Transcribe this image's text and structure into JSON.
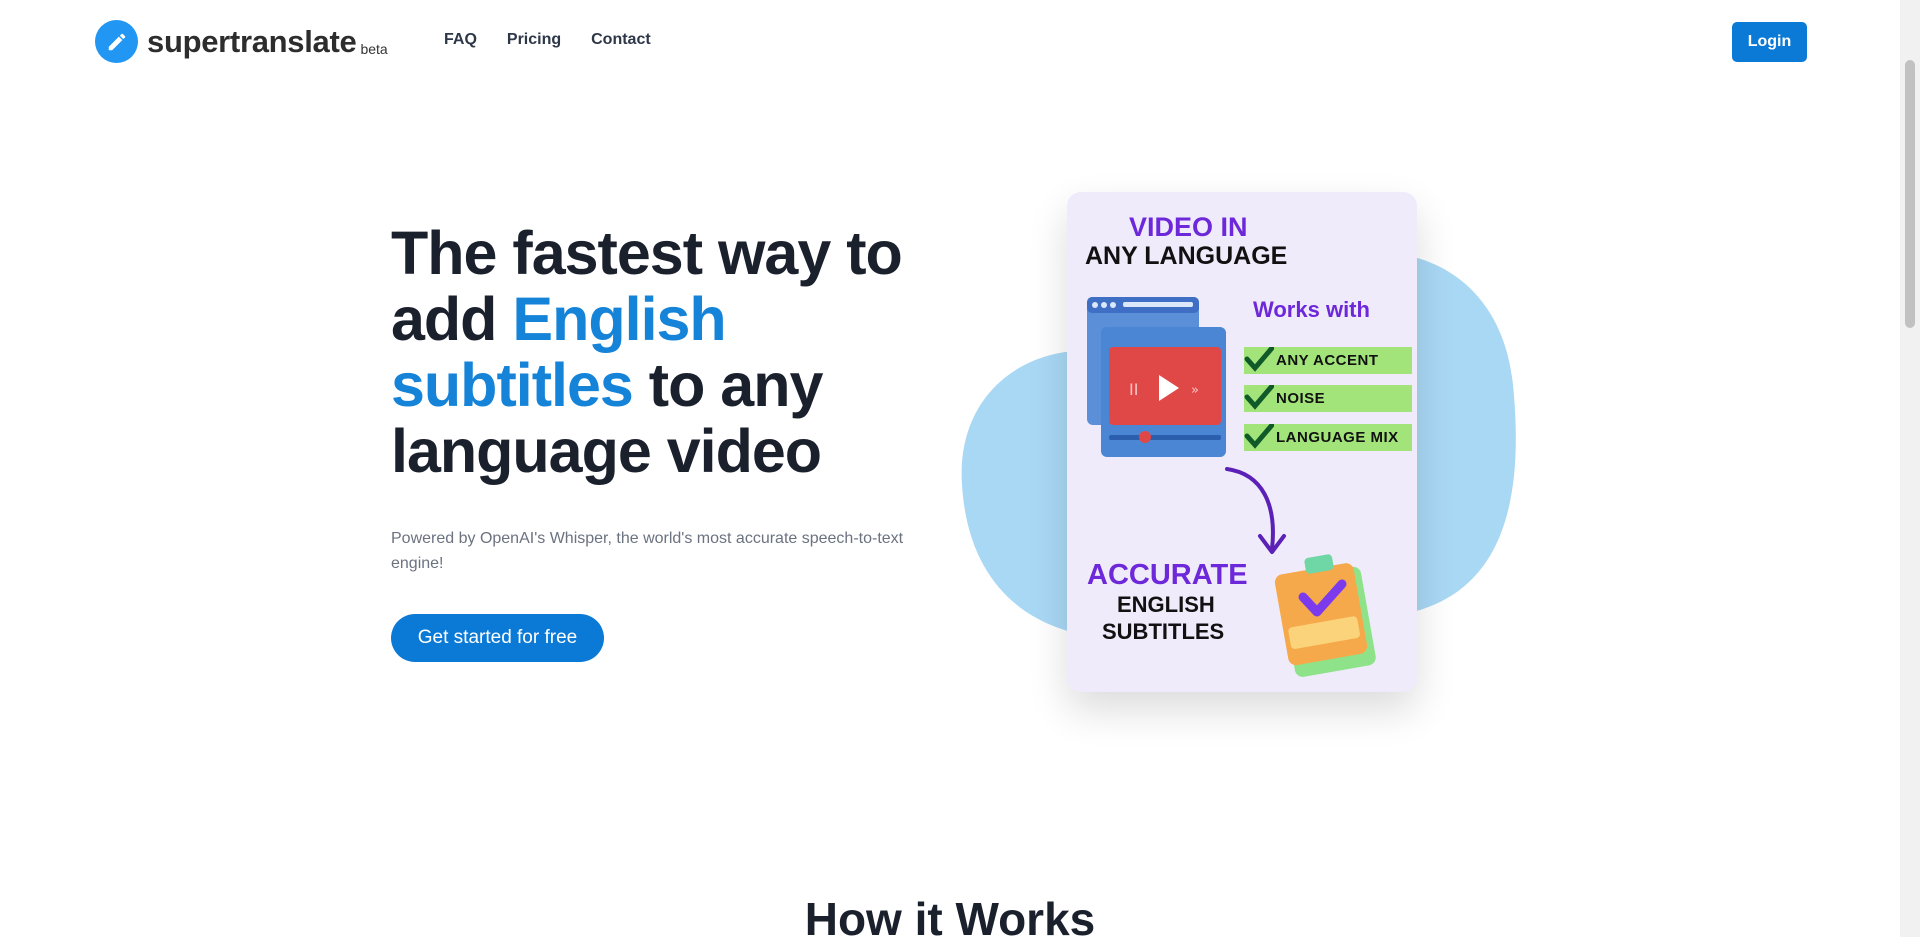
{
  "header": {
    "logo_text": "supertranslate",
    "logo_badge": "beta",
    "logo_icon": "pencil-icon",
    "nav": [
      {
        "label": "FAQ"
      },
      {
        "label": "Pricing"
      },
      {
        "label": "Contact"
      }
    ],
    "login_label": "Login"
  },
  "hero": {
    "title_part1": "The fastest way to add ",
    "title_accent": "English subtitles",
    "title_part2": " to any language video",
    "subtitle": "Powered by OpenAI's Whisper, the world's most accurate speech-to-text engine!",
    "cta_label": "Get started for free"
  },
  "illustration": {
    "heading_1": "VIDEO IN",
    "heading_2": "ANY LANGUAGE",
    "works_with": "Works with",
    "features": [
      "ANY ACCENT",
      "NOISE",
      "LANGUAGE MIX"
    ],
    "result_1": "ACCURATE",
    "result_2": "ENGLISH",
    "result_3": "SUBTITLES",
    "icons": [
      "video-player-icon",
      "check-icon",
      "curved-arrow-icon",
      "clipboard-check-icon"
    ]
  },
  "how_it_works": {
    "title": "How it Works"
  },
  "colors": {
    "accent": "#1583d8",
    "button": "#0b7ad6",
    "purple": "#6d28d9",
    "blob": "#a9d8f5",
    "card_bg": "#efebfb",
    "feature_bg": "#a3e47a"
  }
}
